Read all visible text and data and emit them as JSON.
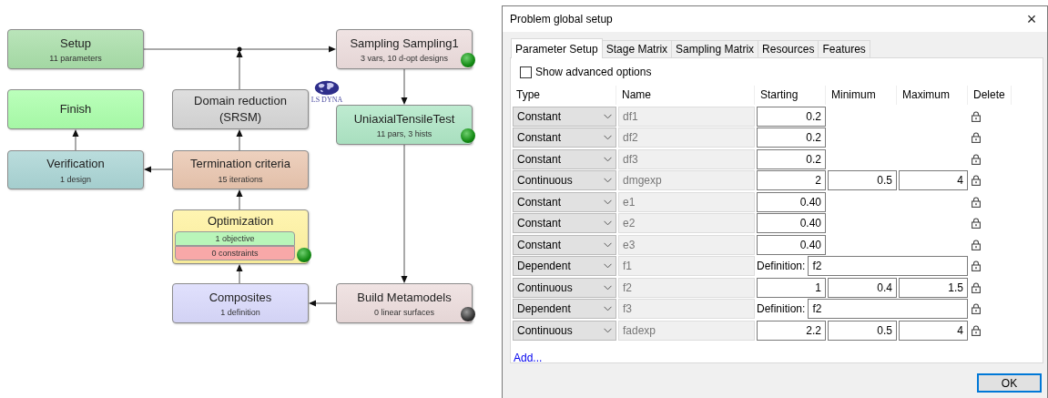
{
  "diagram": {
    "nodes": [
      {
        "title": "Setup",
        "subtitle": "11 parameters",
        "color": "#a8dea8"
      },
      {
        "title": "Finish",
        "color": "#aaffaa"
      },
      {
        "title": "Verification",
        "subtitle": "1 design",
        "color": "#a9d4d4"
      },
      {
        "title": "Domain reduction (SRSM)",
        "color": "#d6d6d6"
      },
      {
        "title": "Termination criteria",
        "subtitle": "15 iterations",
        "color": "#e9c5ae"
      },
      {
        "title": "Optimization",
        "color": "#fff29e",
        "complete": true,
        "rows": [
          {
            "kind": "objective",
            "text": "1 objective"
          },
          {
            "kind": "constraint",
            "text": "0 constraints"
          }
        ]
      },
      {
        "title": "Composites",
        "subtitle": "1 definition",
        "color": "#d9d9fc"
      },
      {
        "title": "Sampling Sampling1",
        "subtitle": "3 vars, 10 d-opt designs",
        "color": "#ecdcdc",
        "complete": true
      },
      {
        "title": "UniaxialTensileTest",
        "subtitle": "11 pars, 3 hists",
        "color": "#aee6c5",
        "complete": true,
        "badge": "LS DYNA"
      },
      {
        "title": "Build Metamodels",
        "subtitle": "0 linear surfaces",
        "color": "#ecdcdc",
        "complete": false
      }
    ]
  },
  "dialog": {
    "title": "Problem global setup",
    "close": "×",
    "tabs": [
      {
        "label": "Parameter Setup",
        "selected": true
      },
      {
        "label": "Stage Matrix",
        "selected": false
      },
      {
        "label": "Sampling Matrix",
        "selected": false
      },
      {
        "label": "Resources",
        "selected": false
      },
      {
        "label": "Features",
        "selected": false
      }
    ],
    "advanced": {
      "label": "Show advanced options",
      "checked": false
    },
    "columns": [
      "Type",
      "Name",
      "Starting",
      "Minimum",
      "Maximum",
      "Delete"
    ],
    "rows": [
      {
        "kind": "constant",
        "type": "Constant",
        "name": "df1",
        "starting": "0.2"
      },
      {
        "kind": "constant",
        "type": "Constant",
        "name": "df2",
        "starting": "0.2"
      },
      {
        "kind": "constant",
        "type": "Constant",
        "name": "df3",
        "starting": "0.2"
      },
      {
        "kind": "continuous",
        "type": "Continuous",
        "name": "dmgexp",
        "starting": "2",
        "minimum": "0.5",
        "maximum": "4"
      },
      {
        "kind": "constant",
        "type": "Constant",
        "name": "e1",
        "starting": "0.40"
      },
      {
        "kind": "constant",
        "type": "Constant",
        "name": "e2",
        "starting": "0.40"
      },
      {
        "kind": "constant",
        "type": "Constant",
        "name": "e3",
        "starting": "0.40"
      },
      {
        "kind": "dependent",
        "type": "Dependent",
        "name": "f1",
        "definition_label": "Definition:",
        "definition": "f2"
      },
      {
        "kind": "continuous",
        "type": "Continuous",
        "name": "f2",
        "starting": "1",
        "minimum": "0.4",
        "maximum": "1.5"
      },
      {
        "kind": "dependent",
        "type": "Dependent",
        "name": "f3",
        "definition_label": "Definition:",
        "definition": "f2"
      },
      {
        "kind": "continuous",
        "type": "Continuous",
        "name": "fadexp",
        "starting": "2.2",
        "minimum": "0.5",
        "maximum": "4"
      }
    ],
    "add_link": "Add...",
    "ok_button": "OK"
  }
}
